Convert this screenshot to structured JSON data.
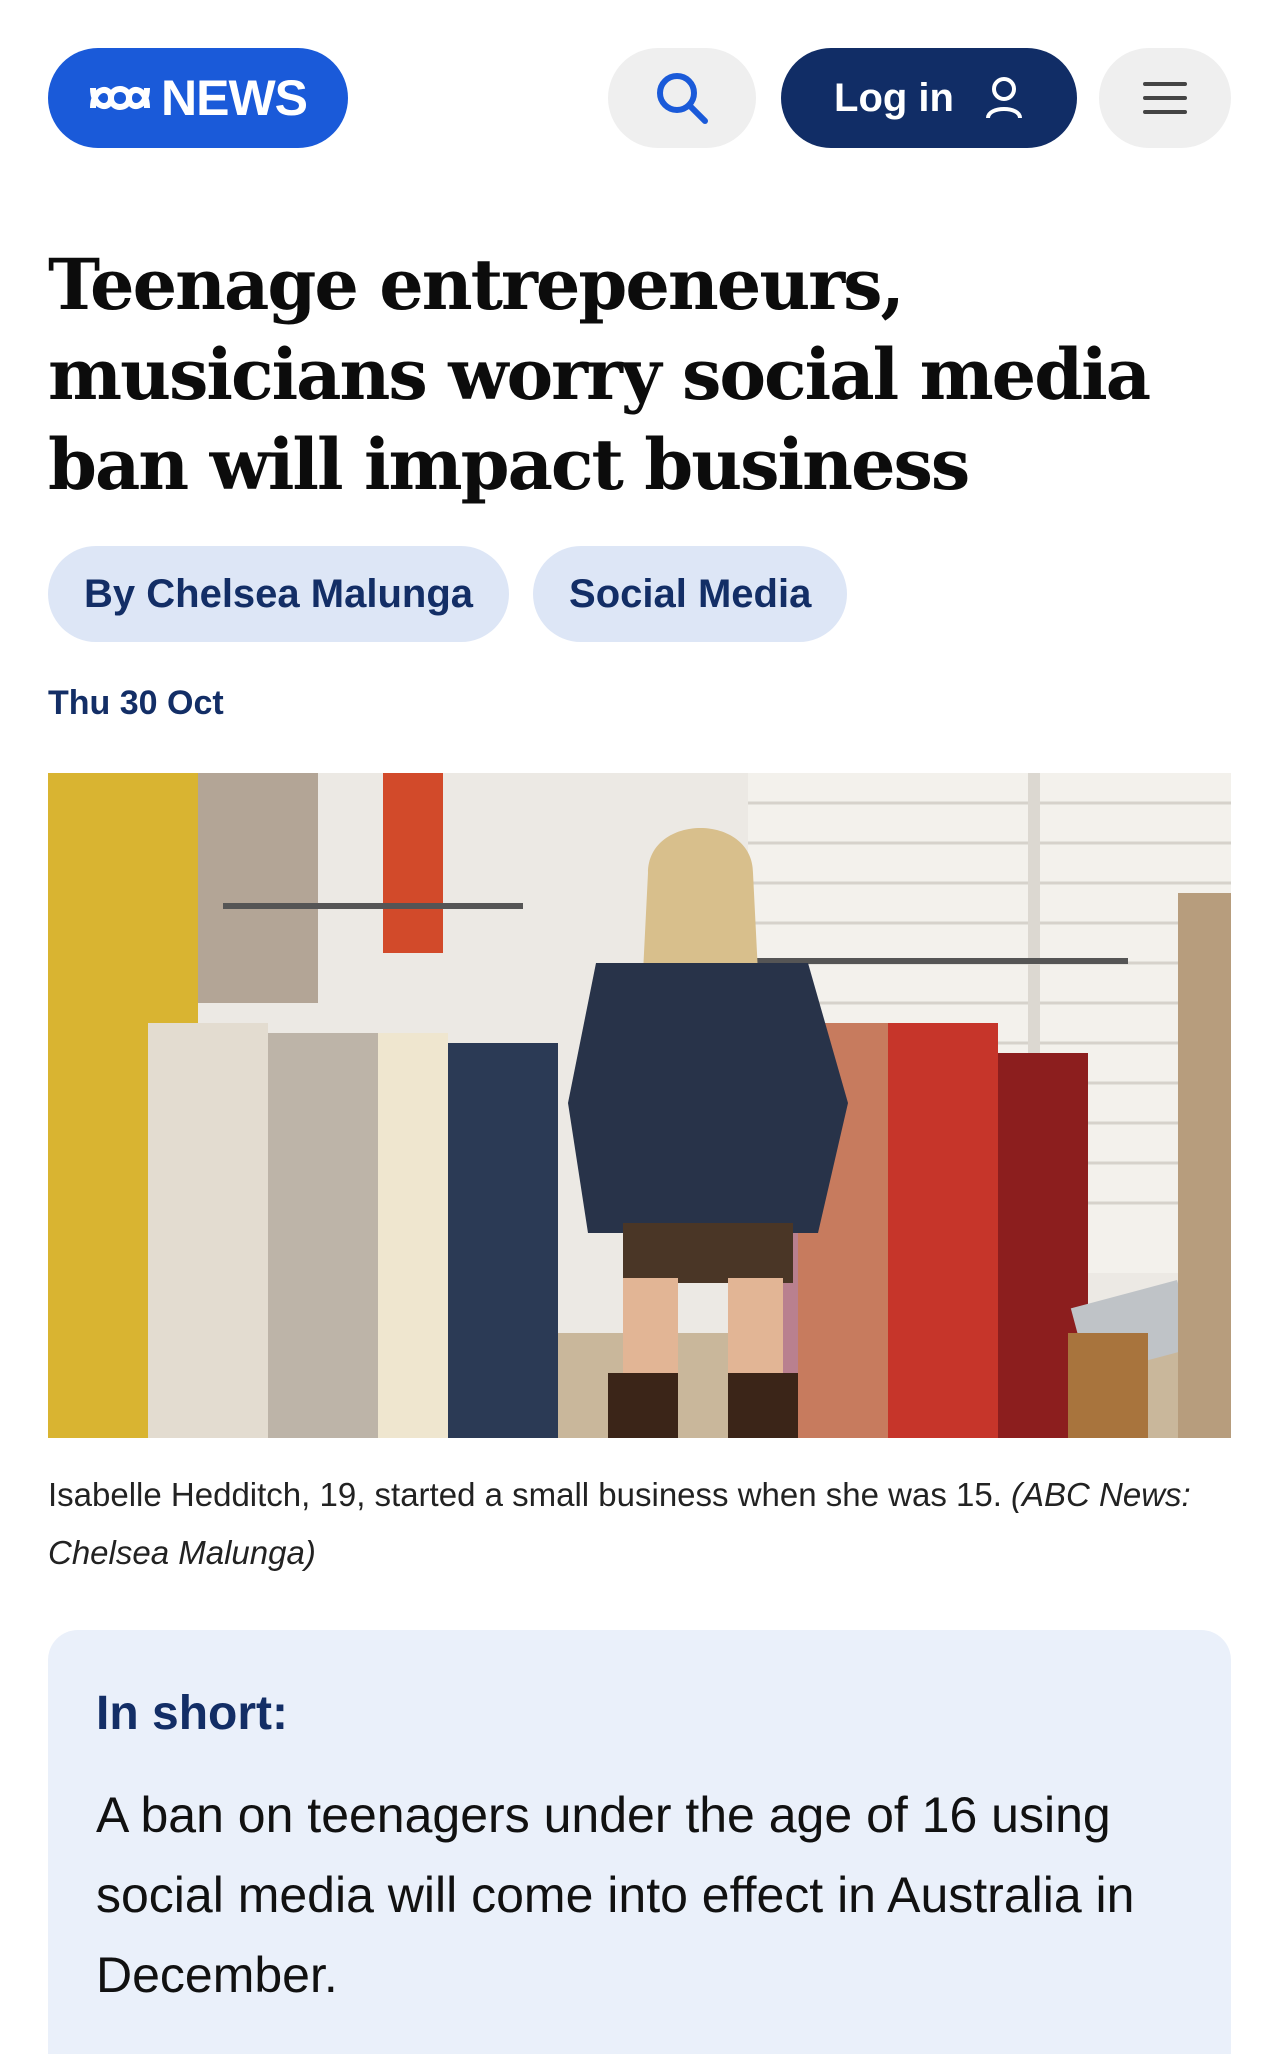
{
  "header": {
    "logo_text": "NEWS",
    "login_label": "Log in",
    "icons": {
      "search": "search-icon",
      "user": "user-icon",
      "menu": "hamburger-menu-icon",
      "logo": "abc-logo-icon"
    },
    "colors": {
      "logo_bg": "#1a5ad9",
      "login_bg": "#112d66",
      "pill_bg": "#efefef"
    }
  },
  "article": {
    "headline": "Teenage entrepeneurs, musicians worry social media ban will impact business",
    "tags": [
      {
        "label": "By Chelsea Malunga"
      },
      {
        "label": "Social Media"
      }
    ],
    "date": "Thu 30 Oct",
    "image": {
      "caption_text": "Isabelle Hedditch, 19, started a small business when she was 15.",
      "caption_credit": "(ABC News: Chelsea Malunga)"
    },
    "in_short": {
      "title": "In short:",
      "body": "A ban on teenagers under the age of 16 using social media will come into effect in Australia in December."
    }
  },
  "colors": {
    "tag_bg": "#dde6f6",
    "tag_text": "#132e66",
    "in_short_bg": "#eaf0fa"
  }
}
